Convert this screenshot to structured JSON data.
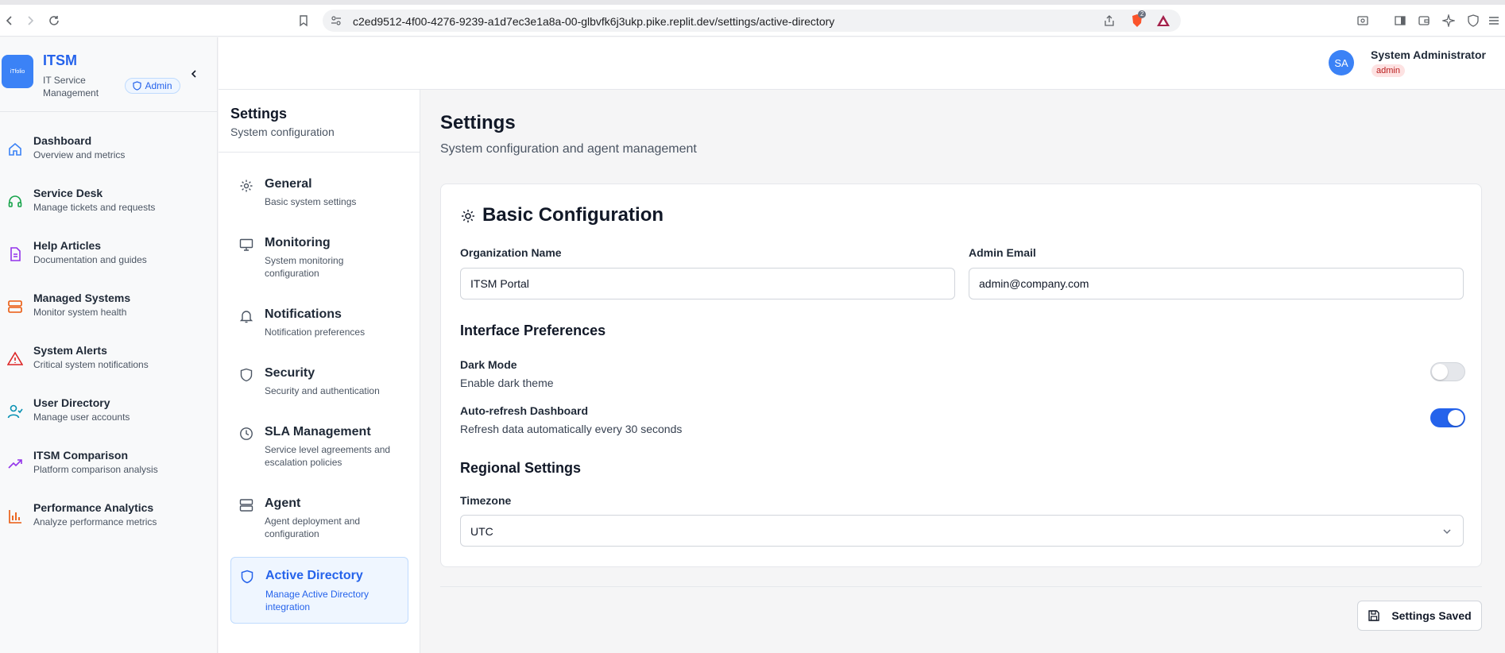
{
  "browser": {
    "url": "c2ed9512-4f00-4276-9239-a1d7ec3e1a8a-00-glbvfk6j3ukp.pike.replit.dev/settings/active-directory",
    "brave_badge_count": "2"
  },
  "brand": {
    "logo_text": "iTfolio",
    "title": "ITSM",
    "subtitle": "IT Service Management",
    "badge": "Admin"
  },
  "sidebar": {
    "items": [
      {
        "label": "Dashboard",
        "desc": "Overview and metrics",
        "icon": "home-icon"
      },
      {
        "label": "Service Desk",
        "desc": "Manage tickets and requests",
        "icon": "headset-icon"
      },
      {
        "label": "Help Articles",
        "desc": "Documentation and guides",
        "icon": "document-icon"
      },
      {
        "label": "Managed Systems",
        "desc": "Monitor system health",
        "icon": "server-icon"
      },
      {
        "label": "System Alerts",
        "desc": "Critical system notifications",
        "icon": "alert-triangle-icon"
      },
      {
        "label": "User Directory",
        "desc": "Manage user accounts",
        "icon": "user-check-icon"
      },
      {
        "label": "ITSM Comparison",
        "desc": "Platform comparison analysis",
        "icon": "trending-up-icon"
      },
      {
        "label": "Performance Analytics",
        "desc": "Analyze performance metrics",
        "icon": "bar-chart-icon"
      }
    ]
  },
  "header": {
    "avatar_initials": "SA",
    "user_name": "System Administrator",
    "role": "admin"
  },
  "settings_nav": {
    "title": "Settings",
    "subtitle": "System configuration",
    "items": [
      {
        "label": "General",
        "desc": "Basic system settings",
        "icon": "gear-icon"
      },
      {
        "label": "Monitoring",
        "desc": "System monitoring configuration",
        "icon": "monitor-icon"
      },
      {
        "label": "Notifications",
        "desc": "Notification preferences",
        "icon": "bell-icon"
      },
      {
        "label": "Security",
        "desc": "Security and authentication",
        "icon": "shield-icon"
      },
      {
        "label": "SLA Management",
        "desc": "Service level agreements and escalation policies",
        "icon": "clock-icon"
      },
      {
        "label": "Agent",
        "desc": "Agent deployment and configuration",
        "icon": "server-icon"
      },
      {
        "label": "Active Directory",
        "desc": "Manage Active Directory integration",
        "icon": "shield-icon",
        "active": true
      }
    ]
  },
  "main": {
    "title": "Settings",
    "subtitle": "System configuration and agent management",
    "card_title": "Basic Configuration",
    "org_name_label": "Organization Name",
    "org_name_value": "ITSM Portal",
    "admin_email_label": "Admin Email",
    "admin_email_value": "admin@company.com",
    "interface_title": "Interface Preferences",
    "dark_mode_label": "Dark Mode",
    "dark_mode_desc": "Enable dark theme",
    "dark_mode_on": false,
    "auto_refresh_label": "Auto-refresh Dashboard",
    "auto_refresh_desc": "Refresh data automatically every 30 seconds",
    "auto_refresh_on": true,
    "regional_title": "Regional Settings",
    "timezone_label": "Timezone",
    "timezone_value": "UTC",
    "save_label": "Settings Saved"
  },
  "colors": {
    "accent": "#2563eb",
    "logo_bg": "#3b82f6",
    "role_badge_bg": "#fde2e2",
    "role_badge_text": "#b91c1c"
  }
}
